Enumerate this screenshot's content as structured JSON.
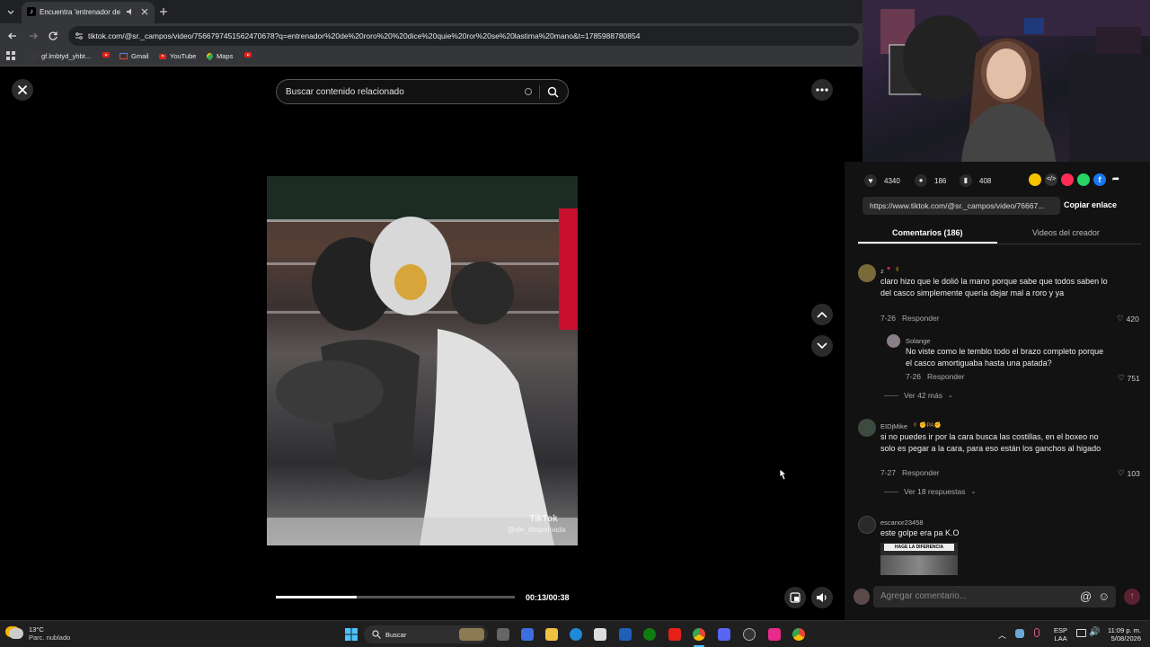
{
  "browser": {
    "tab_title": "Encuentra 'entrenador de r...",
    "url": "tiktok.com/@sr._campos/video/7566797451562470678?q=entrenador%20de%20roro%20%20dice%20quie%20ror%20se%20lastima%20mano&t=1785988780854",
    "bookmarks": [
      "gf.lmbtyd_yhbt...",
      "Gmail",
      "YouTube",
      "Maps"
    ]
  },
  "video": {
    "search_placeholder": "Buscar contenido relacionado",
    "current_time": "00:13",
    "duration": "00:38",
    "timecode": "00:13/00:38",
    "progress": 0.34,
    "watermark_brand": "TikTok",
    "watermark_handle": "@ale_despeinada"
  },
  "panel": {
    "likes": "4340",
    "comments_count": "186",
    "saves": "408",
    "share_link": "https://www.tiktok.com/@sr._campos/video/76667...",
    "copy_label": "Copiar enlace",
    "tab_comments": "Comentarios (186)",
    "tab_creator": "Videos del creador",
    "comments": [
      {
        "user": "z",
        "text": "claro hizo que le dolió la mano porque sabe que todos saben lo del casco simplemente quería dejar mal a roro y ya",
        "date": "7-26",
        "reply": "Responder",
        "likes": "420",
        "replies": [
          {
            "user": "Solange",
            "text": "No viste como le temblo todo el brazo completo porque el casco amortiguaba hasta una patada?",
            "date": "7-26",
            "reply": "Responder",
            "likes": "751"
          }
        ],
        "more": "Ver 42 más"
      },
      {
        "user": "EIDjMike",
        "text": "si no puedes ir por la cara busca las costillas, en el boxeo no solo es pegar a la cara, para eso están los ganchos al higado",
        "date": "7-27",
        "reply": "Responder",
        "likes": "103",
        "more": "Ver 18 respuestas"
      },
      {
        "user": "escanor23458",
        "text": "este golpe era pa K.O",
        "image_caption": "HAGE LA DIFERENCIA"
      }
    ],
    "comment_placeholder": "Agregar comentario..."
  },
  "taskbar": {
    "temp": "13°C",
    "weather": "Parc. nublado",
    "search": "Buscar",
    "lang_top": "ESP",
    "lang_bottom": "LAA",
    "time": "11:09 p. m.",
    "date": "5/08/2026"
  },
  "colors": {
    "accent": "#fe2c55",
    "panel_bg": "#121212",
    "chrome_bg": "#35363a"
  }
}
